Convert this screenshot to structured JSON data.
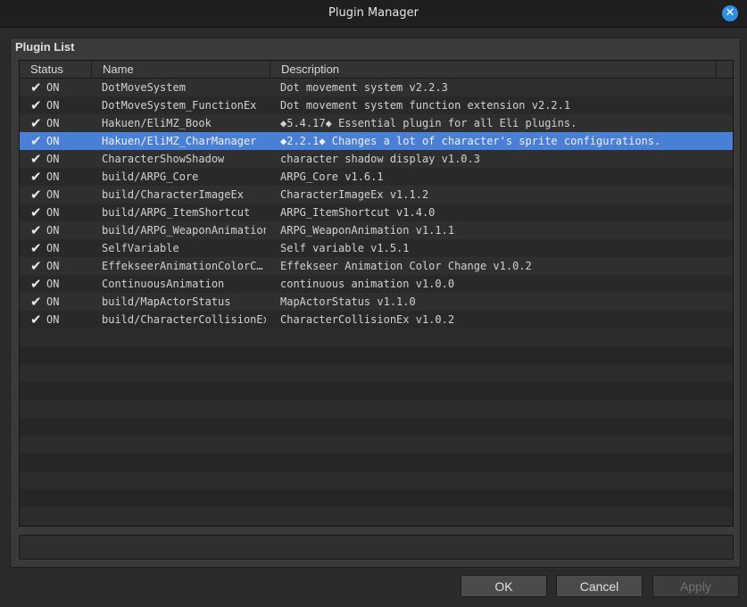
{
  "window": {
    "title": "Plugin Manager"
  },
  "panel": {
    "label": "Plugin List"
  },
  "columns": {
    "status": "Status",
    "name": "Name",
    "description": "Description"
  },
  "check_glyph": "✔",
  "plugins": [
    {
      "status": "ON",
      "name": "DotMoveSystem",
      "description": "Dot movement system v2.2.3"
    },
    {
      "status": "ON",
      "name": "DotMoveSystem_FunctionEx",
      "description": "Dot movement system function extension v2.2.1"
    },
    {
      "status": "ON",
      "name": "Hakuen/EliMZ_Book",
      "description": "◆5.4.17◆ Essential plugin for all Eli plugins."
    },
    {
      "status": "ON",
      "name": "Hakuen/EliMZ_CharManager",
      "description": "◆2.2.1◆ Changes a lot of character's sprite configurations."
    },
    {
      "status": "ON",
      "name": "CharacterShowShadow",
      "description": "character shadow display v1.0.3"
    },
    {
      "status": "ON",
      "name": "build/ARPG_Core",
      "description": "ARPG_Core v1.6.1"
    },
    {
      "status": "ON",
      "name": "build/CharacterImageEx",
      "description": "CharacterImageEx v1.1.2"
    },
    {
      "status": "ON",
      "name": "build/ARPG_ItemShortcut",
      "description": "ARPG_ItemShortcut v1.4.0"
    },
    {
      "status": "ON",
      "name": "build/ARPG_WeaponAnimation",
      "description": "ARPG_WeaponAnimation v1.1.1"
    },
    {
      "status": "ON",
      "name": "SelfVariable",
      "description": "Self variable v1.5.1"
    },
    {
      "status": "ON",
      "name": "EffekseerAnimationColorC…",
      "description": "Effekseer Animation Color Change v1.0.2"
    },
    {
      "status": "ON",
      "name": "ContinuousAnimation",
      "description": "continuous animation v1.0.0"
    },
    {
      "status": "ON",
      "name": "build/MapActorStatus",
      "description": "MapActorStatus v1.1.0"
    },
    {
      "status": "ON",
      "name": "build/CharacterCollisionEx",
      "description": "CharacterCollisionEx v1.0.2"
    }
  ],
  "selected_index": 3,
  "buttons": {
    "ok": "OK",
    "cancel": "Cancel",
    "apply": "Apply"
  }
}
